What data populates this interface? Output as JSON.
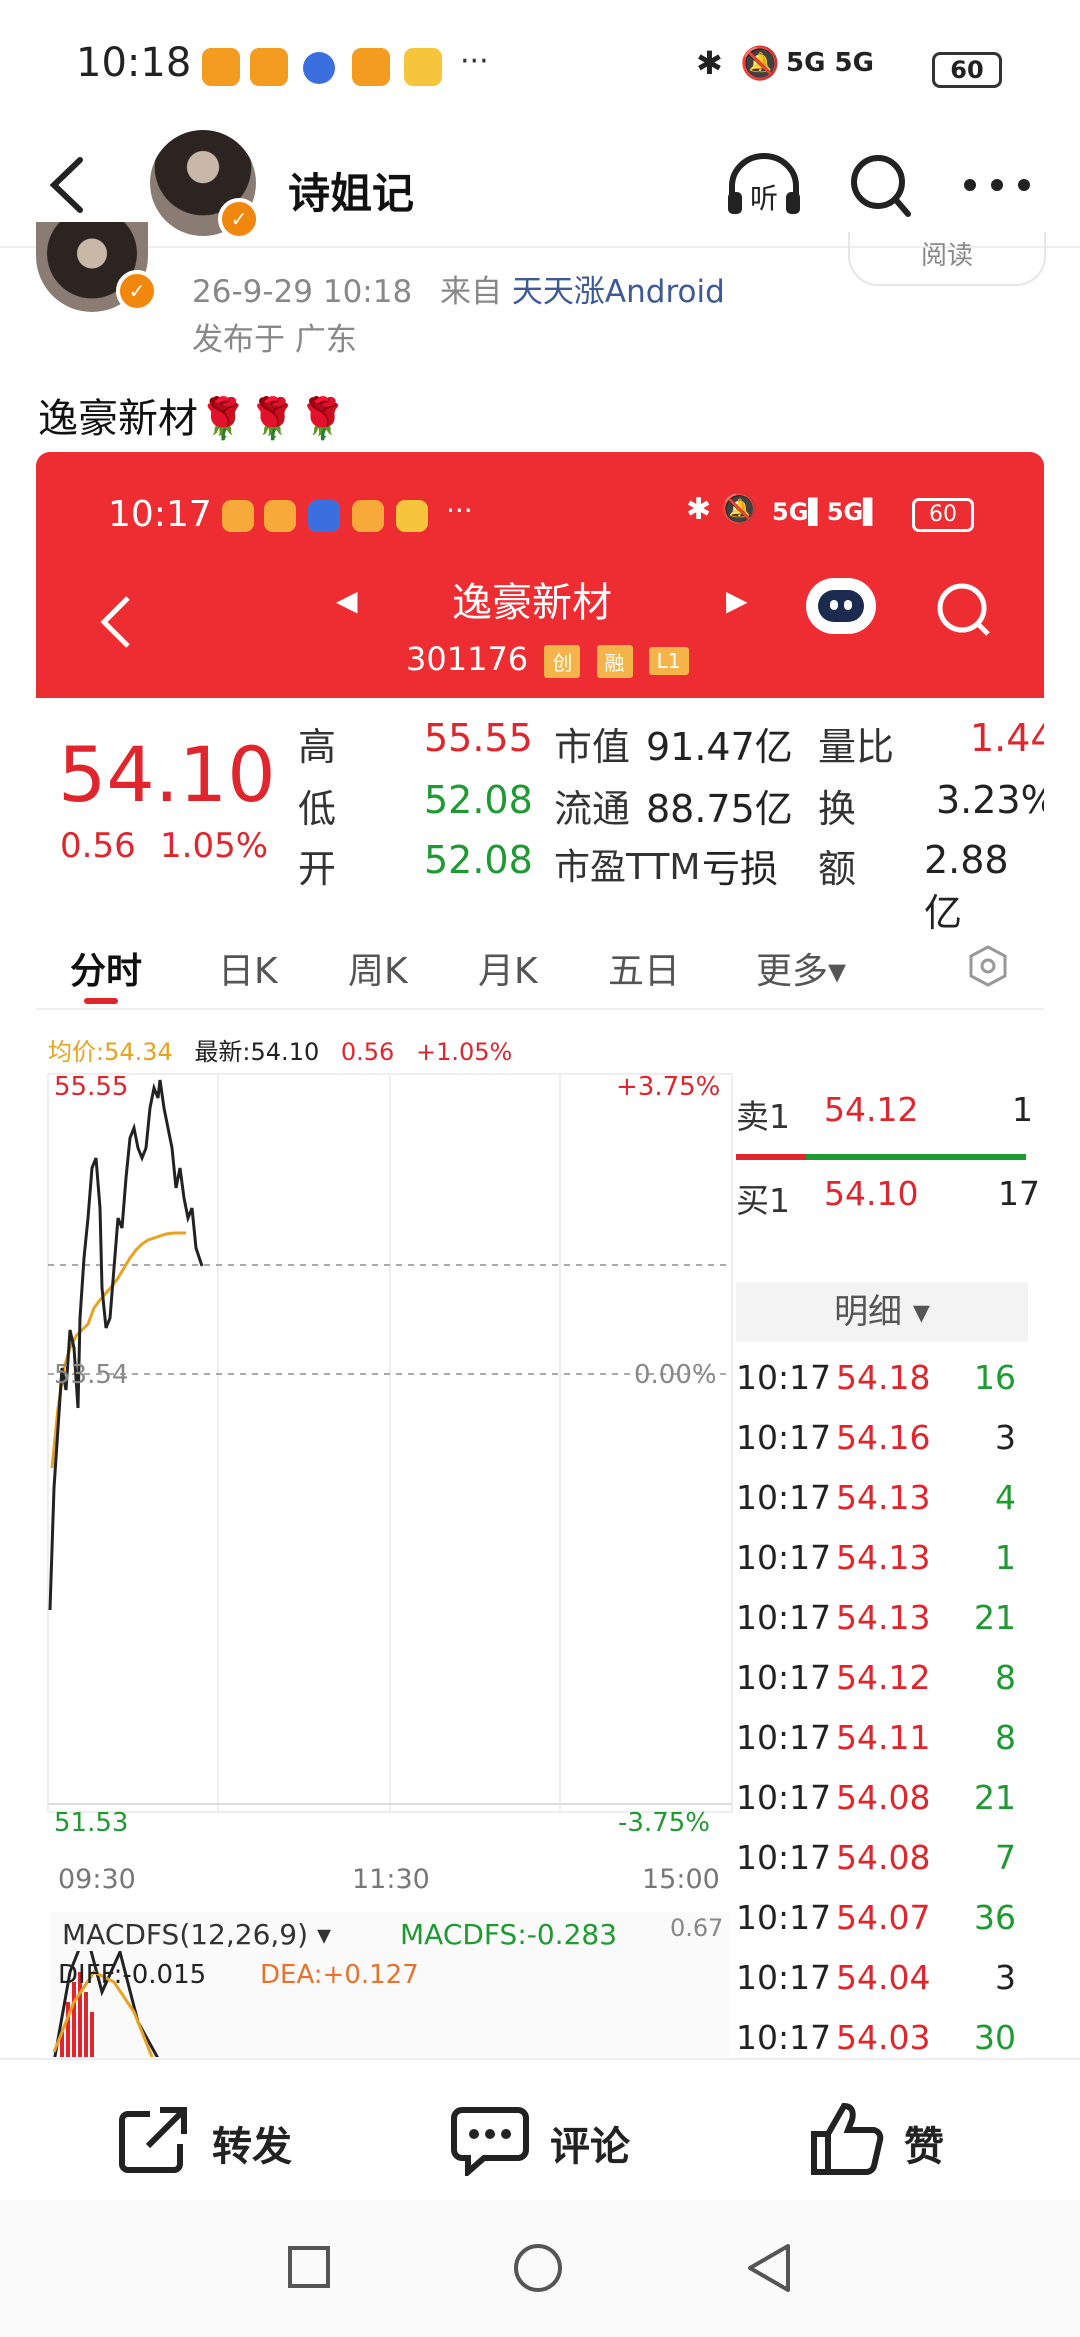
{
  "status_bar": {
    "time": "10:18",
    "more": "···",
    "network": "5G 5G",
    "battery": "60"
  },
  "header": {
    "nickname": "诗姐记"
  },
  "post": {
    "timestamp": "26-9-29 10:18",
    "from_label": "来自",
    "source": "天天涨Android",
    "location": "发布于 广东",
    "read_label": "阅读",
    "text": "逸豪新材🌹🌹🌹"
  },
  "quote": {
    "inner_time": "10:17",
    "inner_more": "···",
    "inner_battery": "60",
    "stock_name": "逸豪新材",
    "stock_code": "301176",
    "tags": [
      "创",
      "融",
      "L1"
    ],
    "price": "54.10",
    "change": "0.56",
    "change_pct": "1.05%",
    "stats": [
      {
        "label": "高",
        "value": "55.55",
        "label2": "市值",
        "value2": "91.47亿",
        "label3": "量比",
        "value3": "1.44"
      },
      {
        "label": "低",
        "value": "52.08",
        "label2": "流通",
        "value2": "88.75亿",
        "label3": "换",
        "value3": "3.23%"
      },
      {
        "label": "开",
        "value": "52.08",
        "label2": "市盈TTM",
        "value2": "亏损",
        "label3": "额",
        "value3": "2.88亿"
      }
    ],
    "tabs": [
      "分时",
      "日K",
      "周K",
      "月K",
      "五日",
      "更多▾"
    ],
    "legend": {
      "avg_label": "均价:54.34",
      "latest_label": "最新:54.10",
      "chg": "0.56",
      "chg_pct": "+1.05%"
    },
    "chart_labels": {
      "high": "55.55",
      "high_pct": "+3.75%",
      "mid": "53.54",
      "mid_pct": "0.00%",
      "low": "51.53",
      "low_pct": "-3.75%",
      "t1": "09:30",
      "t2": "11:30",
      "t3": "15:00"
    },
    "macd": {
      "title": "MACDFS(12,26,9) ▾",
      "value": "MACDFS:-0.283",
      "right": "0.67",
      "diff": "DIFF:-0.015",
      "dea": "DEA:+0.127"
    },
    "order_book": {
      "sell": {
        "label": "卖1",
        "price": "54.12",
        "vol": "1"
      },
      "buy": {
        "label": "买1",
        "price": "54.10",
        "vol": "17"
      },
      "detail_label": "明细 ▾"
    },
    "ticks": [
      {
        "time": "10:17",
        "price": "54.18",
        "vol": "16",
        "dir": "up"
      },
      {
        "time": "10:17",
        "price": "54.16",
        "vol": "3",
        "dir": "down"
      },
      {
        "time": "10:17",
        "price": "54.13",
        "vol": "4",
        "dir": "up"
      },
      {
        "time": "10:17",
        "price": "54.13",
        "vol": "1",
        "dir": "up"
      },
      {
        "time": "10:17",
        "price": "54.13",
        "vol": "21",
        "dir": "up"
      },
      {
        "time": "10:17",
        "price": "54.12",
        "vol": "8",
        "dir": "up"
      },
      {
        "time": "10:17",
        "price": "54.11",
        "vol": "8",
        "dir": "up"
      },
      {
        "time": "10:17",
        "price": "54.08",
        "vol": "21",
        "dir": "up"
      },
      {
        "time": "10:17",
        "price": "54.08",
        "vol": "7",
        "dir": "up"
      },
      {
        "time": "10:17",
        "price": "54.07",
        "vol": "36",
        "dir": "up"
      },
      {
        "time": "10:17",
        "price": "54.04",
        "vol": "3",
        "dir": "down"
      },
      {
        "time": "10:17",
        "price": "54.03",
        "vol": "30",
        "dir": "up"
      }
    ]
  },
  "actions": {
    "repost": "转发",
    "comment": "评论",
    "like": "赞"
  },
  "colors": {
    "quote_red": "#ee2d33",
    "up": "#e0262c",
    "down": "#1f9a32",
    "link": "#3d5a96",
    "badge": "#f2870e"
  }
}
